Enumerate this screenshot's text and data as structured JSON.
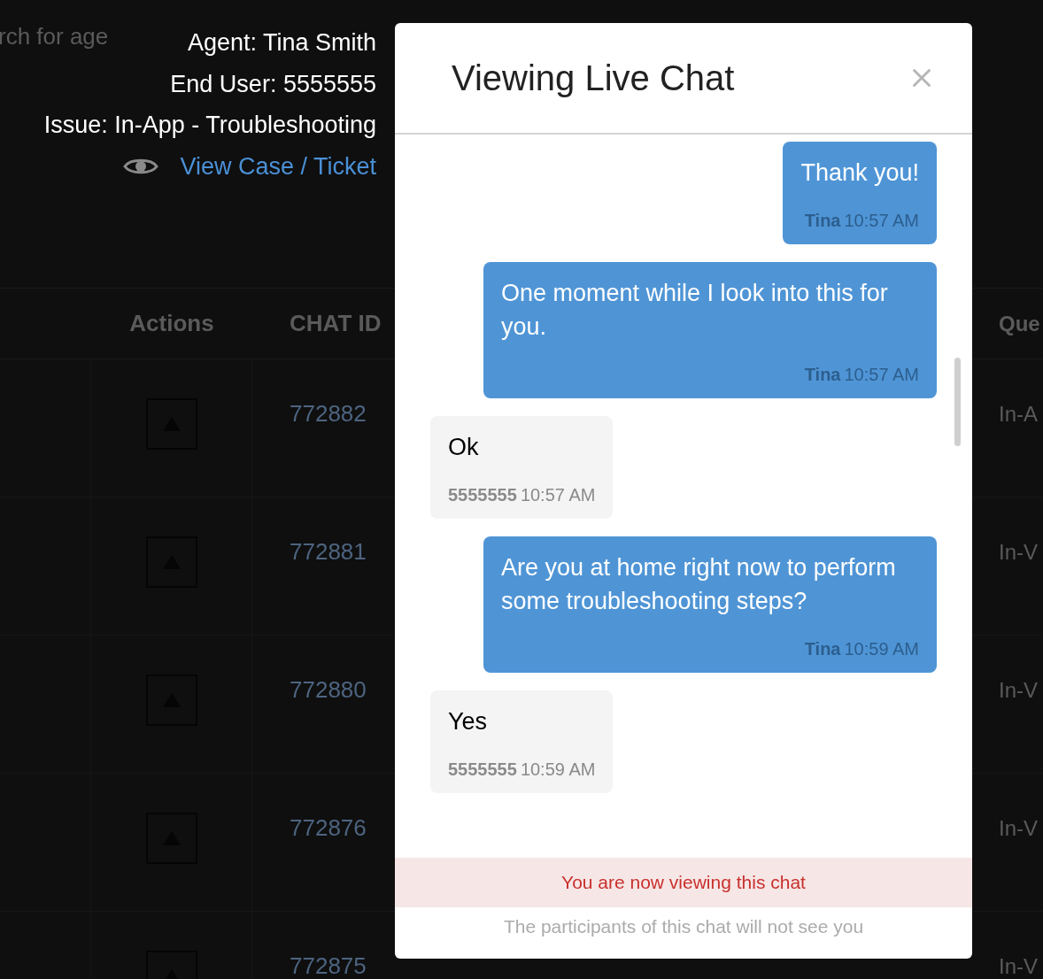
{
  "info": {
    "agent": "Agent: Tina Smith",
    "end_user": "End User: 5555555",
    "issue": "Issue: In-App - Troubleshooting",
    "link": "View Case / Ticket"
  },
  "background": {
    "search_text": "rch for age",
    "columns": [
      "Actions",
      "CHAT ID",
      "Que"
    ],
    "rows": [
      {
        "chat_id": "772882",
        "queue": "In-A"
      },
      {
        "chat_id": "772881",
        "queue": "In-V"
      },
      {
        "chat_id": "772880",
        "queue": "In-V"
      },
      {
        "chat_id": "772876",
        "queue": "In-V"
      },
      {
        "chat_id": "772875",
        "queue": "In-V"
      }
    ]
  },
  "modal": {
    "title": "Viewing Live Chat",
    "messages": [
      {
        "kind": "agent",
        "text": "Thank you!",
        "sender": "Tina",
        "time": "10:57 AM"
      },
      {
        "kind": "agent",
        "text": "One moment while I look into this for you.",
        "sender": "Tina",
        "time": "10:57 AM"
      },
      {
        "kind": "user",
        "text": "Ok",
        "sender": "5555555",
        "time": "10:57 AM"
      },
      {
        "kind": "agent",
        "text": "Are you at home right now to perform some troubleshooting steps?",
        "sender": "Tina",
        "time": "10:59 AM"
      },
      {
        "kind": "user",
        "text": "Yes",
        "sender": "5555555",
        "time": "10:59 AM"
      }
    ],
    "notice": "You are now viewing this chat",
    "subnotice": "The participants of this chat will not see you"
  }
}
